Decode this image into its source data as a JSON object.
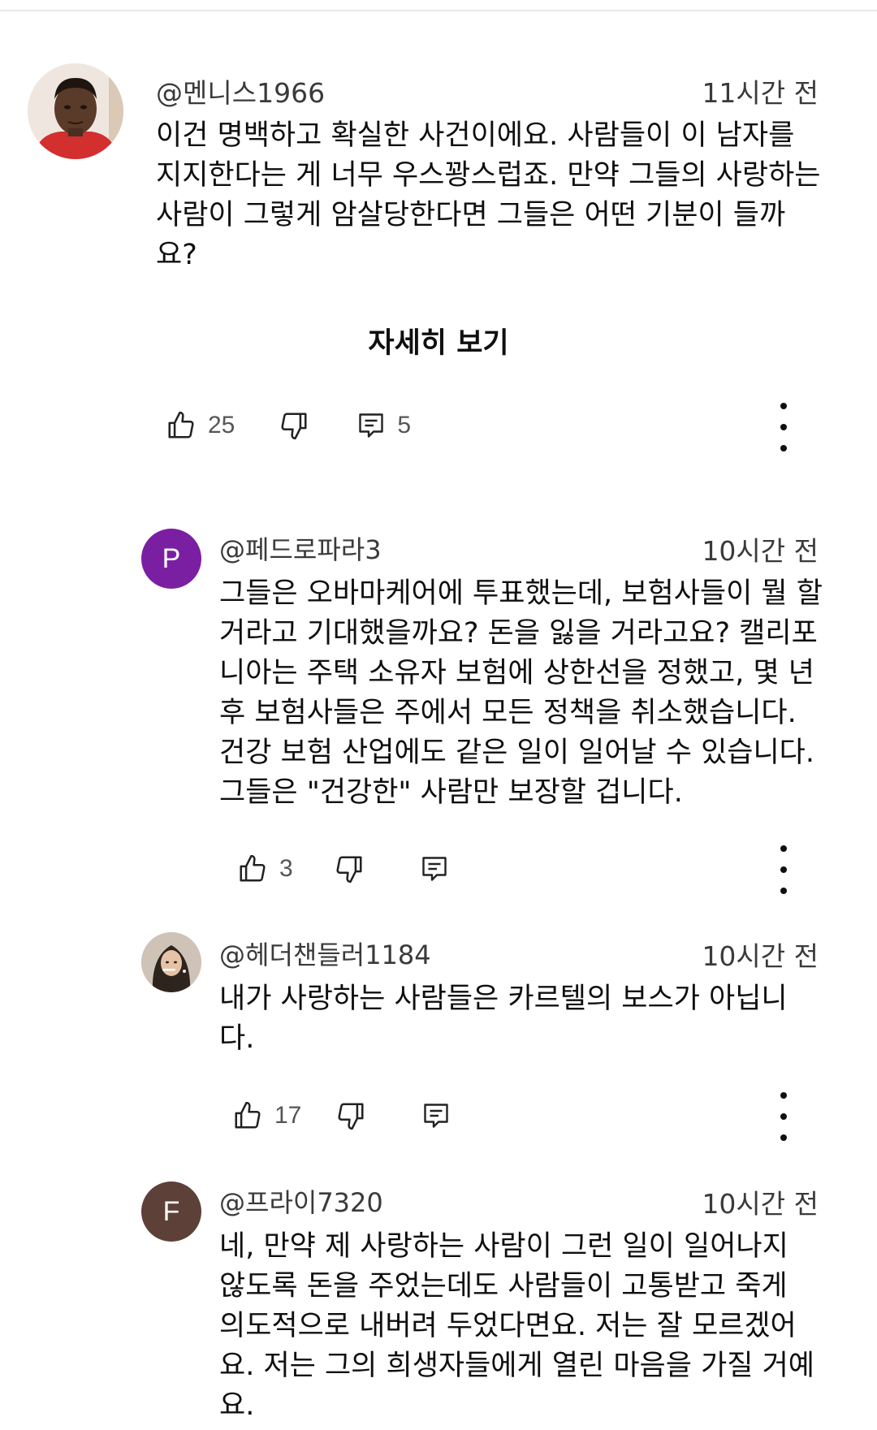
{
  "comments": [
    {
      "author": "@멘니스1966",
      "time": "11시간 전",
      "text": "이건 명백하고 확실한 사건이에요. 사람들이 이 남자를 지지한다는 게 너무 우스꽝스럽죠. 만약 그들의 사랑하는 사람이 그렇게 암살당한다면 그들은 어떤 기분이 들까요?",
      "read_more": "자세히 보기",
      "likes": "25",
      "replies": "5",
      "avatar_letter": ""
    },
    {
      "author": "@페드로파라3",
      "time": "10시간 전",
      "text": "그들은 오바마케어에 투표했는데, 보험사들이 뭘 할 거라고 기대했을까요? 돈을 잃을 거라고요? 캘리포니아는 주택 소유자 보험에 상한선을 정했고, 몇 년 후 보험사들은 주에서 모든 정책을 취소했습니다. 건강 보험 산업에도 같은 일이 일어날 수 있습니다. 그들은 \"건강한\" 사람만 보장할 겁니다.",
      "likes": "3",
      "avatar_letter": "P",
      "avatar_color": "#7b1fa2"
    },
    {
      "author": "@헤더챈들러1184",
      "time": "10시간 전",
      "text": "내가 사랑하는 사람들은 카르텔의 보스가 아닙니다.",
      "likes": "17",
      "avatar_letter": ""
    },
    {
      "author": "@프라이7320",
      "time": "10시간 전",
      "text": "네, 만약 제 사랑하는 사람이 그런 일이 일어나지 않도록 돈을 주었는데도 사람들이 고통받고 죽게 의도적으로 내버려 두었다면요. 저는 잘 모르겠어요. 저는 그의 희생자들에게 열린 마음을 가질 거예요.",
      "avatar_letter": "F",
      "avatar_color": "#5d4037"
    }
  ],
  "icons": {
    "like": "thumbs-up-icon",
    "dislike": "thumbs-down-icon",
    "reply": "reply-icon",
    "more": "more-vertical-icon"
  }
}
